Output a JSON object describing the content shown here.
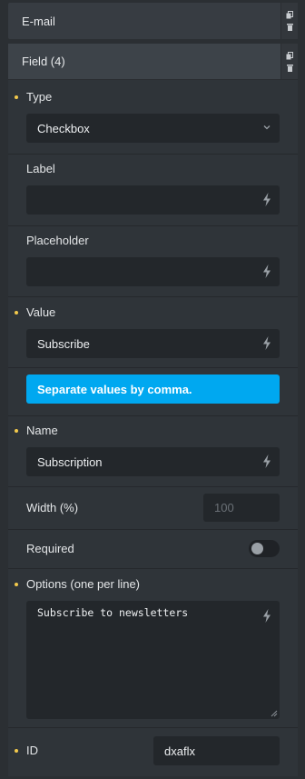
{
  "panels": {
    "email_title": "E-mail",
    "field_title": "Field (4)"
  },
  "type": {
    "label": "Type",
    "value": "Checkbox"
  },
  "label": {
    "label": "Label",
    "value": ""
  },
  "placeholder": {
    "label": "Placeholder",
    "value": ""
  },
  "value": {
    "label": "Value",
    "value": "Subscribe"
  },
  "notice": "Separate values by comma.",
  "name": {
    "label": "Name",
    "value": "Subscription"
  },
  "width": {
    "label": "Width (%)",
    "placeholder": "100"
  },
  "required": {
    "label": "Required",
    "enabled": false
  },
  "options": {
    "label": "Options (one per line)",
    "value": "Subscribe to newsletters"
  },
  "id": {
    "label": "ID",
    "value": "dxaflx"
  },
  "icons": {
    "copy": "copy-icon",
    "delete": "trash-icon",
    "dynamic": "lightning-bolt-icon",
    "chevron": "chevron-down-icon"
  },
  "colors": {
    "accent": "#00a8f0",
    "dot": "#f2c94c",
    "background": "#2b2f33",
    "input": "#23272b"
  }
}
